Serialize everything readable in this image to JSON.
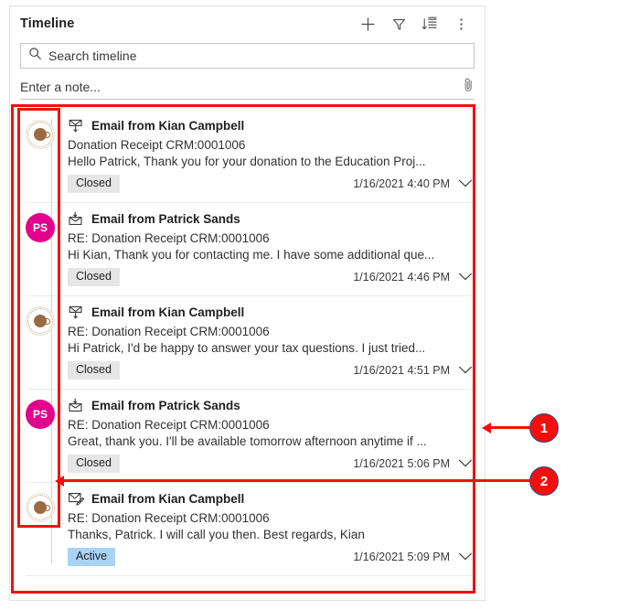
{
  "panel": {
    "title": "Timeline",
    "header_actions": [
      {
        "name": "add-icon",
        "label": "Add"
      },
      {
        "name": "filter-icon",
        "label": "Filter"
      },
      {
        "name": "sort-icon",
        "label": "Sort"
      },
      {
        "name": "more-options-icon",
        "label": "More commands"
      }
    ],
    "search": {
      "placeholder": "Search timeline",
      "value": "",
      "icon": "search-icon"
    },
    "note": {
      "placeholder": "Enter a note...",
      "value": "",
      "attach_icon": "paperclip-icon"
    }
  },
  "timeline": {
    "items": [
      {
        "avatar": {
          "type": "logo",
          "initials": ""
        },
        "icon": "email-closed-icon",
        "title": "Email from Kian Campbell",
        "subject": "Donation Receipt CRM:0001006",
        "snippet": "Hello Patrick,   Thank you for your donation to the Education Proj...",
        "status": "Closed",
        "status_kind": "closed",
        "timestamp": "1/16/2021 4:40 PM",
        "expand_icon": "chevron-down-icon"
      },
      {
        "avatar": {
          "type": "initials",
          "initials": "PS"
        },
        "icon": "email-received-icon",
        "title": "Email from Patrick Sands",
        "subject": "RE: Donation Receipt CRM:0001006",
        "snippet": "Hi Kian, Thank you for contacting me. I have some additional que...",
        "status": "Closed",
        "status_kind": "closed",
        "timestamp": "1/16/2021 4:46 PM",
        "expand_icon": "chevron-down-icon"
      },
      {
        "avatar": {
          "type": "logo",
          "initials": ""
        },
        "icon": "email-closed-icon",
        "title": "Email from Kian Campbell",
        "subject": "RE: Donation Receipt CRM:0001006",
        "snippet": "Hi Patrick,   I'd be happy to answer your tax questions. I just tried...",
        "status": "Closed",
        "status_kind": "closed",
        "timestamp": "1/16/2021 4:51 PM",
        "expand_icon": "chevron-down-icon"
      },
      {
        "avatar": {
          "type": "initials",
          "initials": "PS"
        },
        "icon": "email-received-icon",
        "title": "Email from Patrick Sands",
        "subject": "RE: Donation Receipt CRM:0001006",
        "snippet": "Great, thank you. I'll be available tomorrow afternoon anytime if ...",
        "status": "Closed",
        "status_kind": "closed",
        "timestamp": "1/16/2021 5:06 PM",
        "expand_icon": "chevron-down-icon"
      },
      {
        "avatar": {
          "type": "logo",
          "initials": ""
        },
        "icon": "email-draft-icon",
        "title": "Email from Kian Campbell",
        "subject": "RE: Donation Receipt CRM:0001006",
        "snippet": "Thanks, Patrick. I will call you then.   Best regards, Kian",
        "status": "Active",
        "status_kind": "active",
        "timestamp": "1/16/2021 5:09 PM",
        "expand_icon": "chevron-down-icon"
      }
    ]
  },
  "annotations": {
    "callouts": [
      {
        "number": "1",
        "target": "timeline-records-region"
      },
      {
        "number": "2",
        "target": "timeline-avatar-column-region"
      }
    ]
  },
  "colors": {
    "annotation_red": "#f40f0f",
    "avatar_magenta": "#e3008c",
    "badge_active_blue": "#a9d3f5",
    "badge_closed_gray": "#e6e6e6"
  }
}
